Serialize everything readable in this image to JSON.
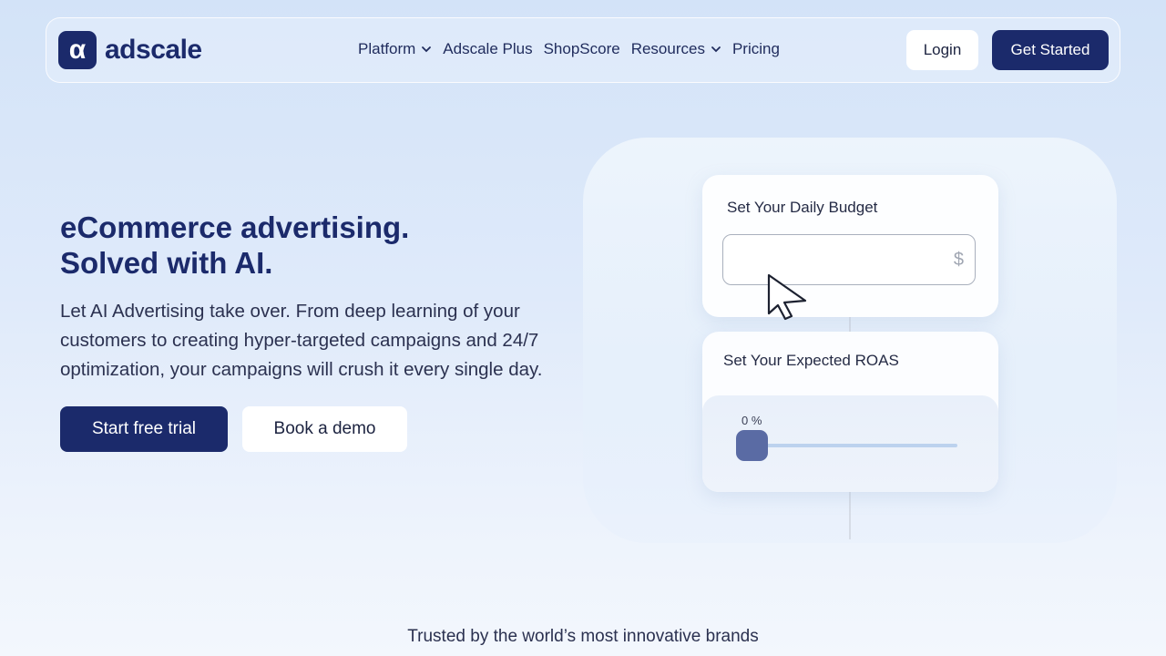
{
  "brand": {
    "logo_glyph": "α",
    "name": "adscale",
    "color": "#1b2a6b"
  },
  "nav": {
    "items": [
      {
        "label": "Platform",
        "has_dropdown": true
      },
      {
        "label": "Adscale Plus",
        "has_dropdown": false
      },
      {
        "label": "ShopScore",
        "has_dropdown": false
      },
      {
        "label": "Resources",
        "has_dropdown": true
      },
      {
        "label": "Pricing",
        "has_dropdown": false
      }
    ],
    "login_label": "Login",
    "get_started_label": "Get Started"
  },
  "hero": {
    "title_line1": "eCommerce advertising.",
    "title_line2": "Solved with AI.",
    "subtitle": "Let AI Advertising take over. From deep learning of your customers to creating hyper-targeted campaigns and 24/7 optimization, your campaigns will crush it every single day.",
    "primary_cta": "Start free trial",
    "secondary_cta": "Book a demo"
  },
  "illustration": {
    "budget_label": "Set Your Daily Budget",
    "budget_value": "",
    "currency_symbol": "$",
    "roas_label": "Set Your Expected ROAS",
    "roas_value_label": "0 %",
    "roas_value": 0
  },
  "trusted_text": "Trusted by the world’s most innovative brands"
}
